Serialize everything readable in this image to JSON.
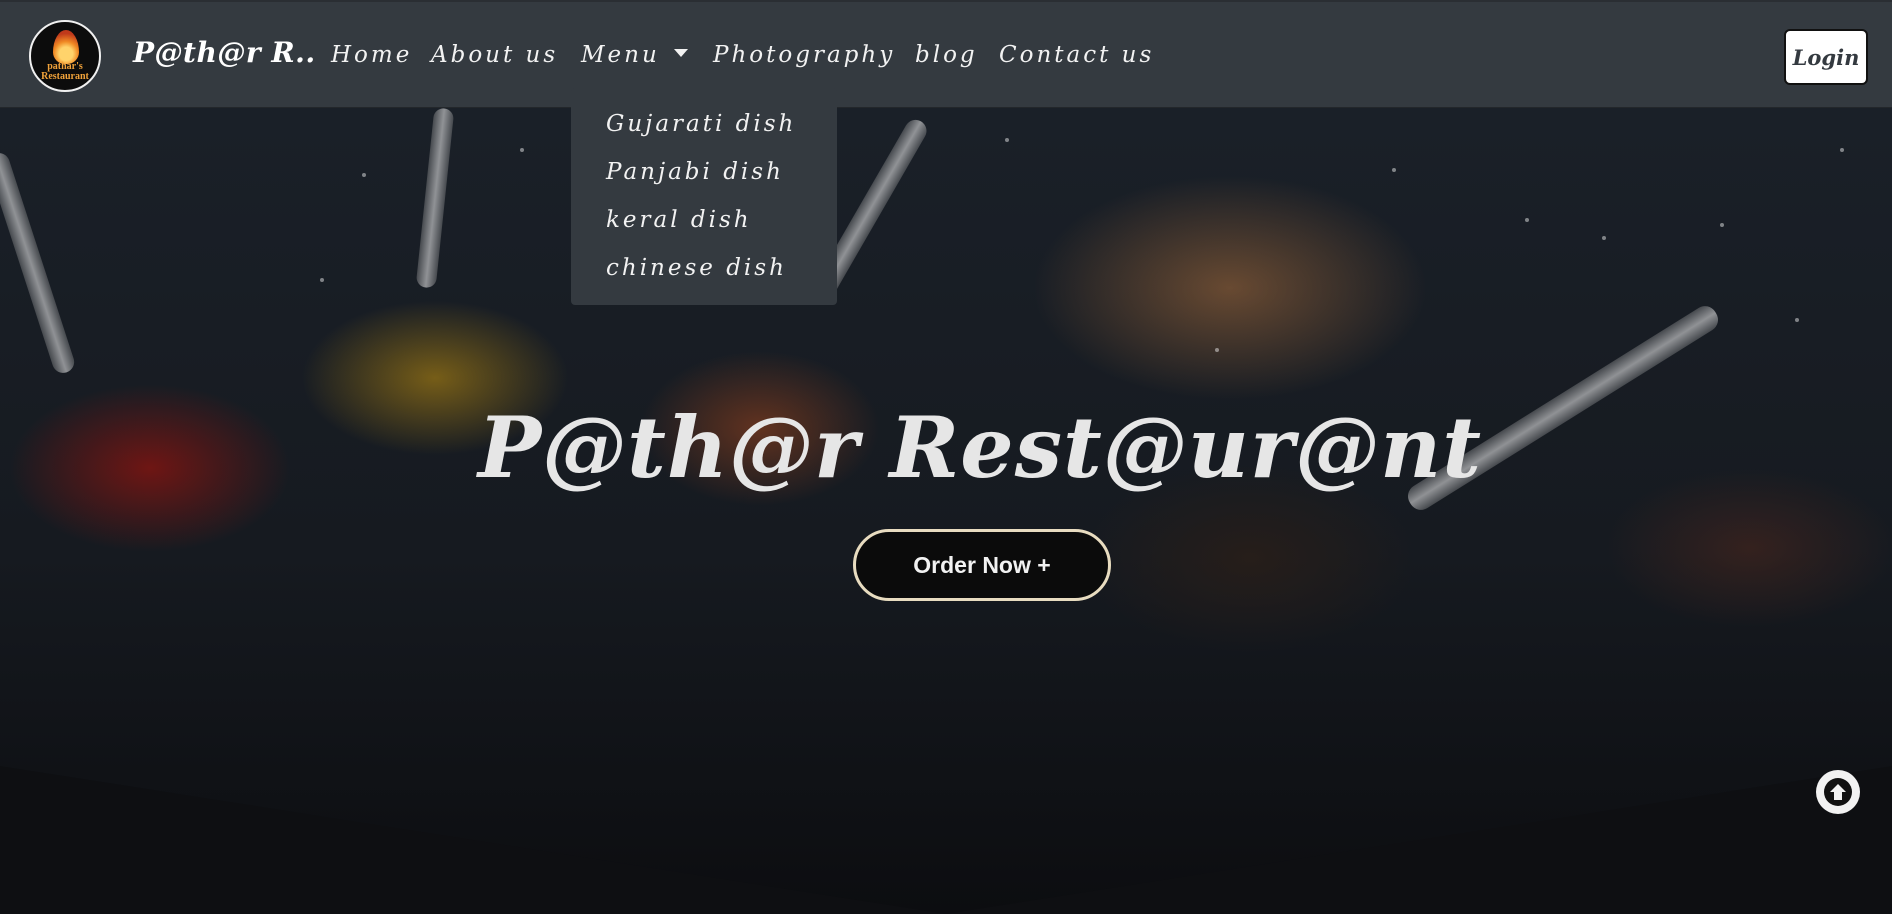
{
  "brand": {
    "logo_text": "pathar's Restaurant",
    "name": "P@th@r R.."
  },
  "nav": {
    "items": [
      "Home",
      "About us",
      "Menu",
      "Photography",
      "blog",
      "Contact us"
    ],
    "login_label": "Login"
  },
  "dropdown": {
    "items": [
      "Gujarati dish",
      "Panjabi dish",
      "keral dish",
      "chinese dish"
    ]
  },
  "hero": {
    "title": "P@th@r Rest@ur@nt",
    "order_button": "Order Now +"
  },
  "colors": {
    "navbar": "#343a40",
    "dropdown": "#343a40",
    "order_button_border": "#e8dcc0"
  },
  "icons": {
    "menu_toggle": "caret-down-icon",
    "scroll_top": "arrow-up-circle-icon"
  }
}
